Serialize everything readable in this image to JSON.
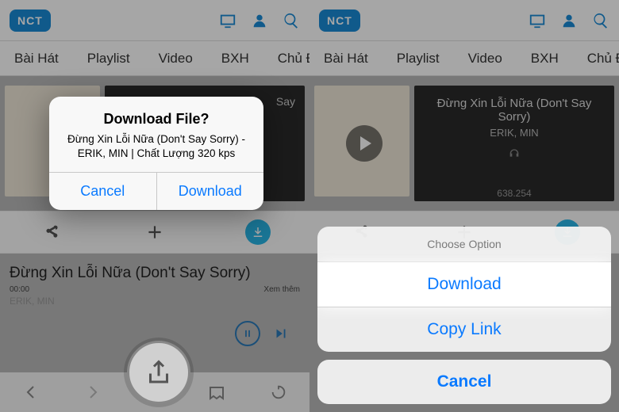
{
  "logo": "NCT",
  "tabs": [
    "Bài Hát",
    "Playlist",
    "Video",
    "BXH",
    "Chủ Đ"
  ],
  "tile": {
    "title": "Đừng Xin Lỗi Nữa (Don't Say Sorry)",
    "artist": "ERIK, MIN",
    "plays": "638.254"
  },
  "tile2_suffix": "Say",
  "actions": {
    "share": "share",
    "add": "add",
    "download": "download"
  },
  "now_playing": {
    "title": "Đừng Xin Lỗi Nữa (Don't Say Sorry)",
    "time": "00:00",
    "more": "Xem thêm",
    "artist_line": "ERIK, MIN"
  },
  "alert": {
    "title": "Download File?",
    "message": "Đừng Xin Lỗi Nữa (Don't Say Sorry) - ERIK, MIN | Chất Lượng 320 kps",
    "cancel": "Cancel",
    "confirm": "Download"
  },
  "sheet": {
    "title": "Choose Option",
    "opt1": "Download",
    "opt2": "Copy Link",
    "cancel": "Cancel"
  }
}
